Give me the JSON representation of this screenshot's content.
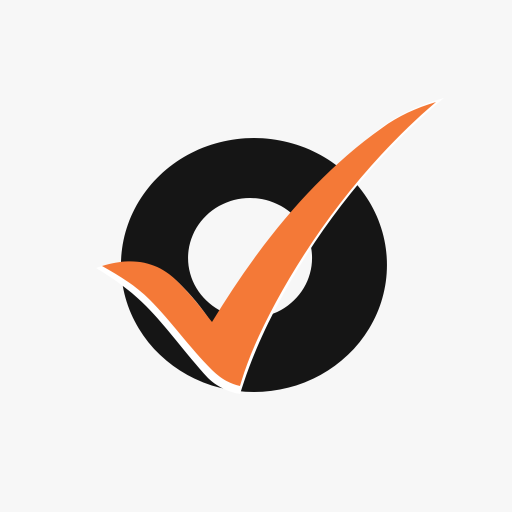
{
  "logo": {
    "icon": "checkmark-ring-logo-icon",
    "colors": {
      "background": "#f7f7f7",
      "ring": "#151515",
      "check": "#f47937",
      "outline": "#ffffff"
    }
  }
}
